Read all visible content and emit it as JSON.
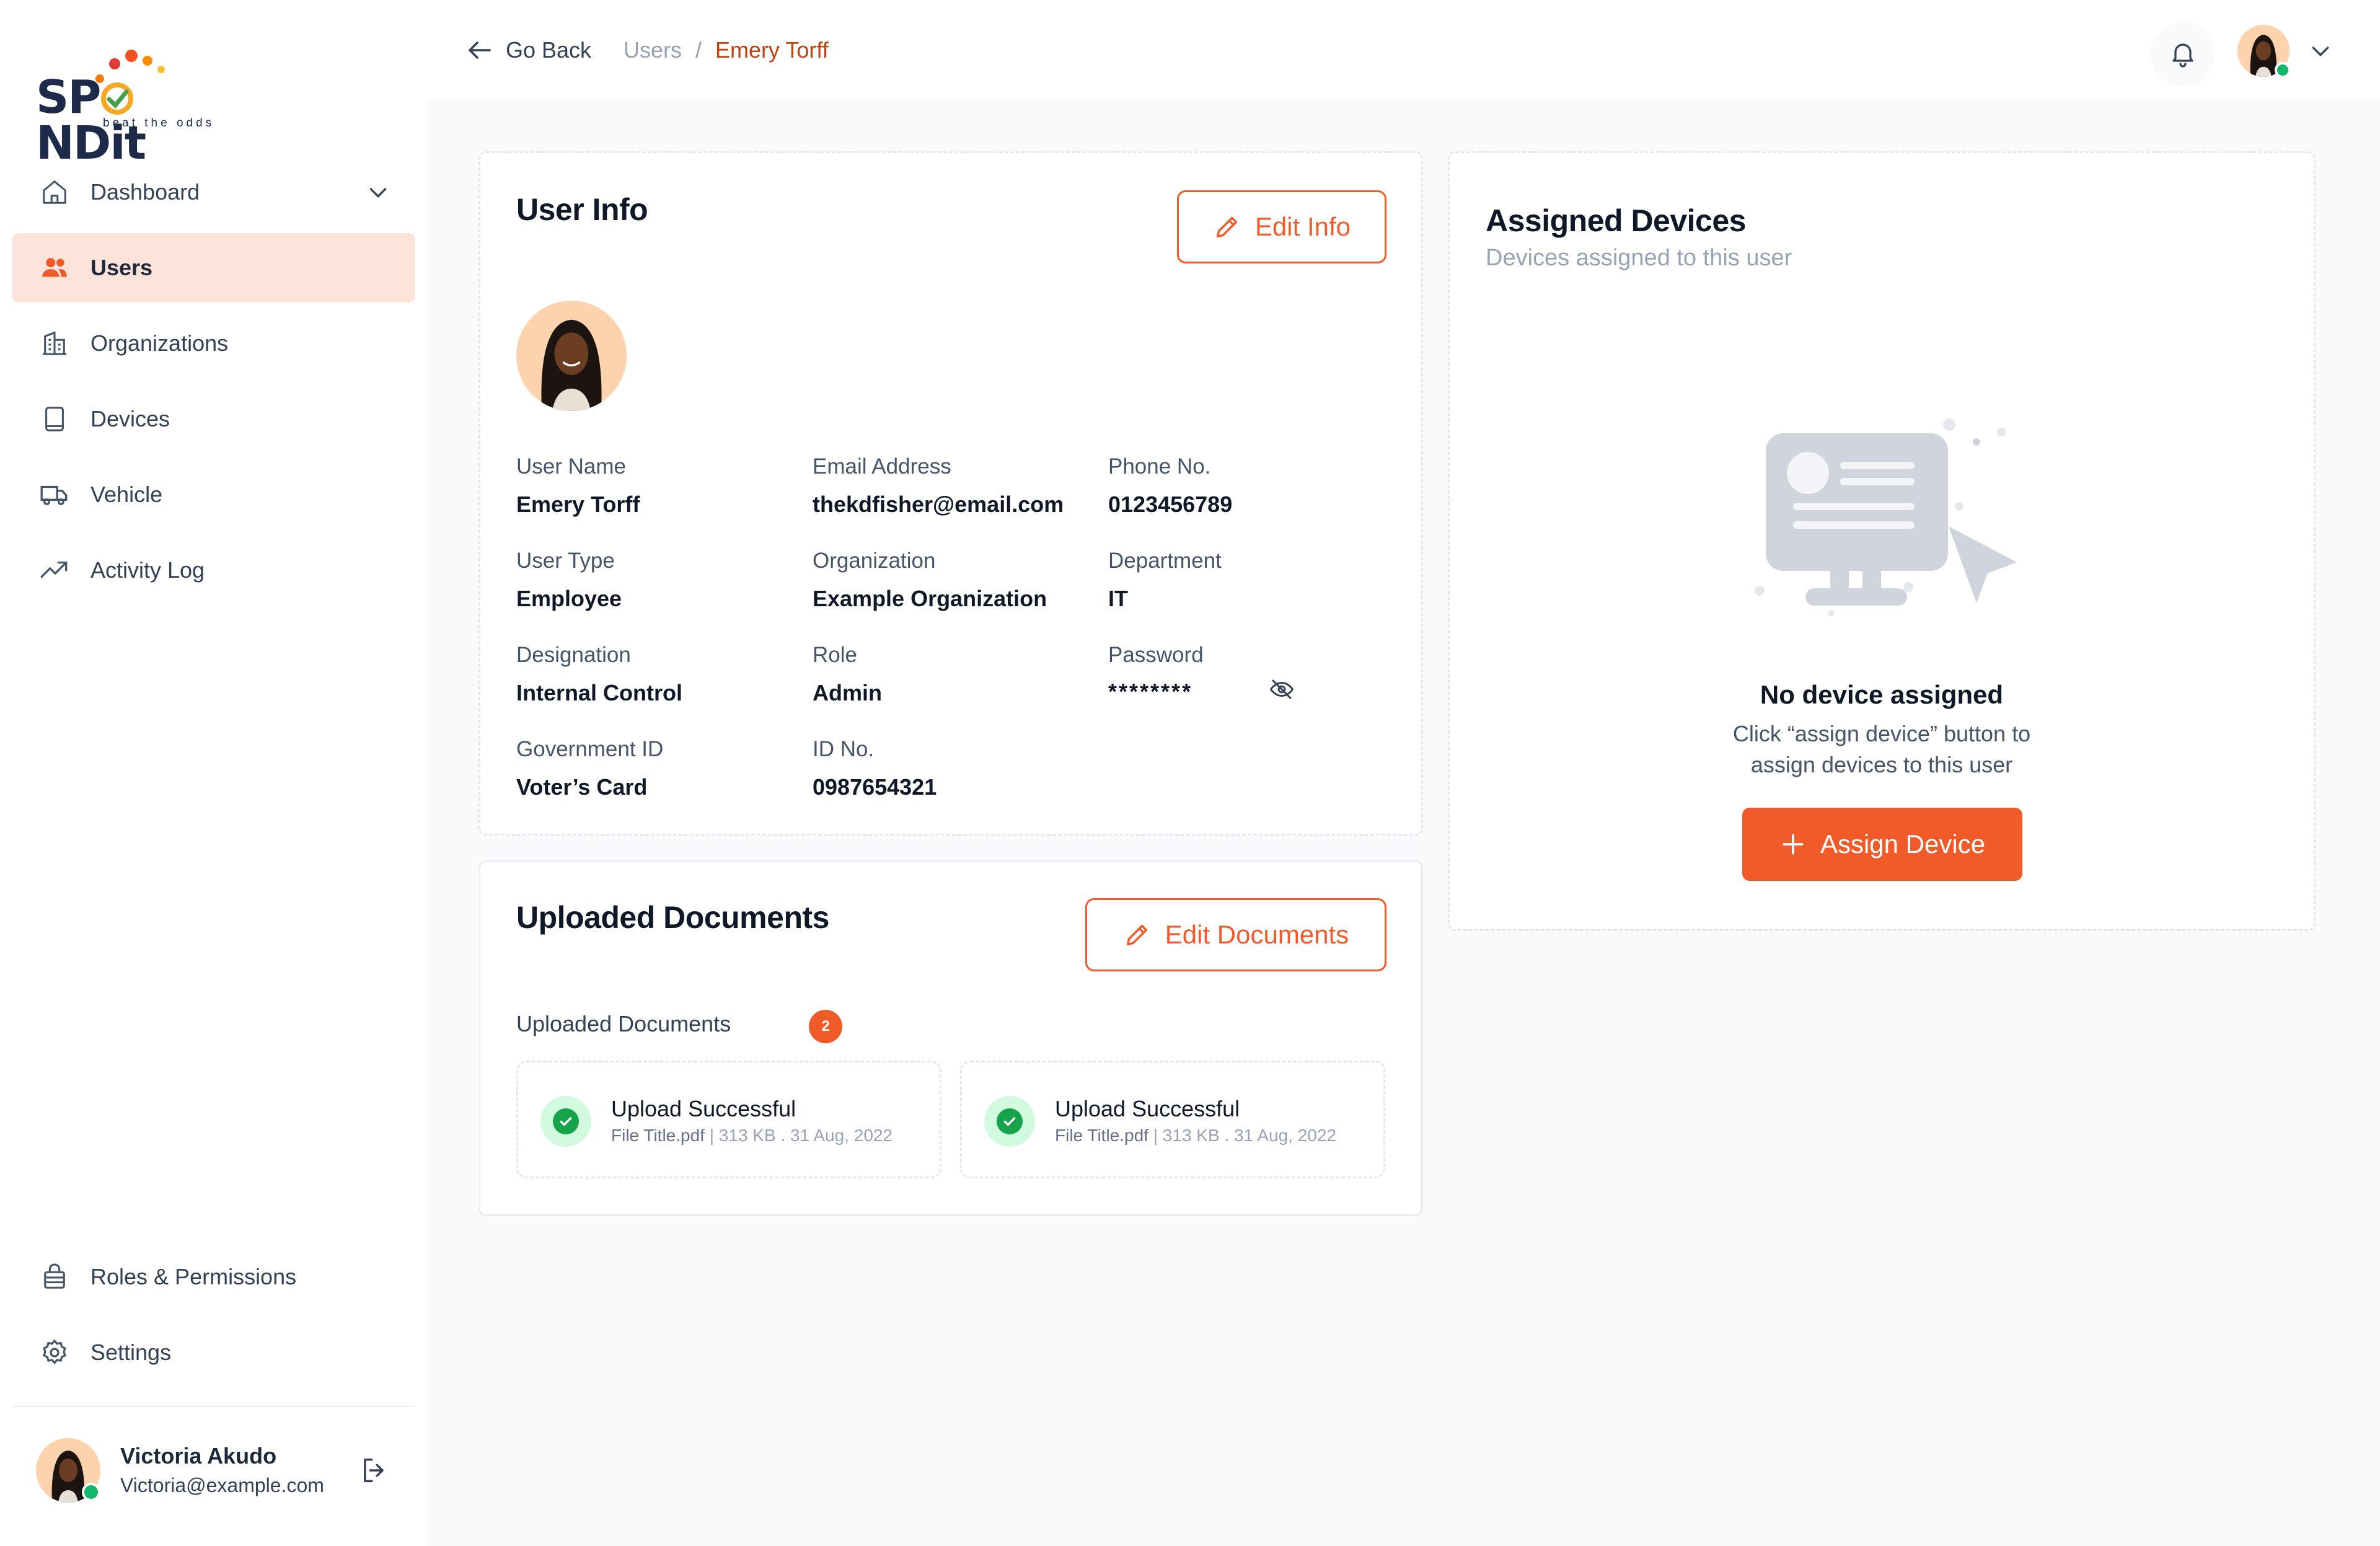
{
  "brand": {
    "name": "SP",
    "name_rest": "NDit",
    "tagline": "beat the odds"
  },
  "sidebar": {
    "items": [
      {
        "label": "Dashboard"
      },
      {
        "label": "Users"
      },
      {
        "label": "Organizations"
      },
      {
        "label": "Devices"
      },
      {
        "label": "Vehicle"
      },
      {
        "label": "Activity Log"
      }
    ],
    "bottom_items": [
      {
        "label": "Roles & Permissions"
      },
      {
        "label": "Settings"
      }
    ],
    "profile": {
      "name": "Victoria Akudo",
      "email": "Victoria@example.com"
    }
  },
  "header": {
    "back_label": "Go Back",
    "breadcrumb": {
      "parent": "Users",
      "separator": "/",
      "current": "Emery Torff"
    }
  },
  "user_info": {
    "title": "User Info",
    "edit_label": "Edit Info",
    "fields": [
      {
        "label": "User Name",
        "value": "Emery Torff"
      },
      {
        "label": "Email Address",
        "value": "thekdfisher@email.com"
      },
      {
        "label": "Phone No.",
        "value": "0123456789"
      },
      {
        "label": "User Type",
        "value": "Employee"
      },
      {
        "label": "Organization",
        "value": "Example Organization"
      },
      {
        "label": "Department",
        "value": "IT"
      },
      {
        "label": "Designation",
        "value": "Internal Control"
      },
      {
        "label": "Role",
        "value": "Admin"
      },
      {
        "label": "Password",
        "value": "********"
      },
      {
        "label": "Government ID",
        "value": "Voter’s Card"
      },
      {
        "label": "ID No.",
        "value": "0987654321"
      }
    ]
  },
  "documents": {
    "title": "Uploaded Documents",
    "edit_label": "Edit Documents",
    "list_label": "Uploaded Documents",
    "count": "2",
    "items": [
      {
        "status": "Upload Successful",
        "file": "File Title.pdf",
        "sep": "|",
        "meta": "313 KB . 31 Aug, 2022"
      },
      {
        "status": "Upload Successful",
        "file": "File Title.pdf",
        "sep": "|",
        "meta": "313 KB . 31 Aug, 2022"
      }
    ]
  },
  "assigned_devices": {
    "title": "Assigned Devices",
    "subtitle": "Devices assigned to this user",
    "empty_title": "No device assigned",
    "empty_line1": "Click “assign device” button to",
    "empty_line2": "assign devices to this user",
    "button_label": "Assign Device"
  },
  "colors": {
    "accent": "#f15a29",
    "active_bg": "#fde3d9",
    "success": "#16a34a",
    "online": "#12b76a"
  }
}
